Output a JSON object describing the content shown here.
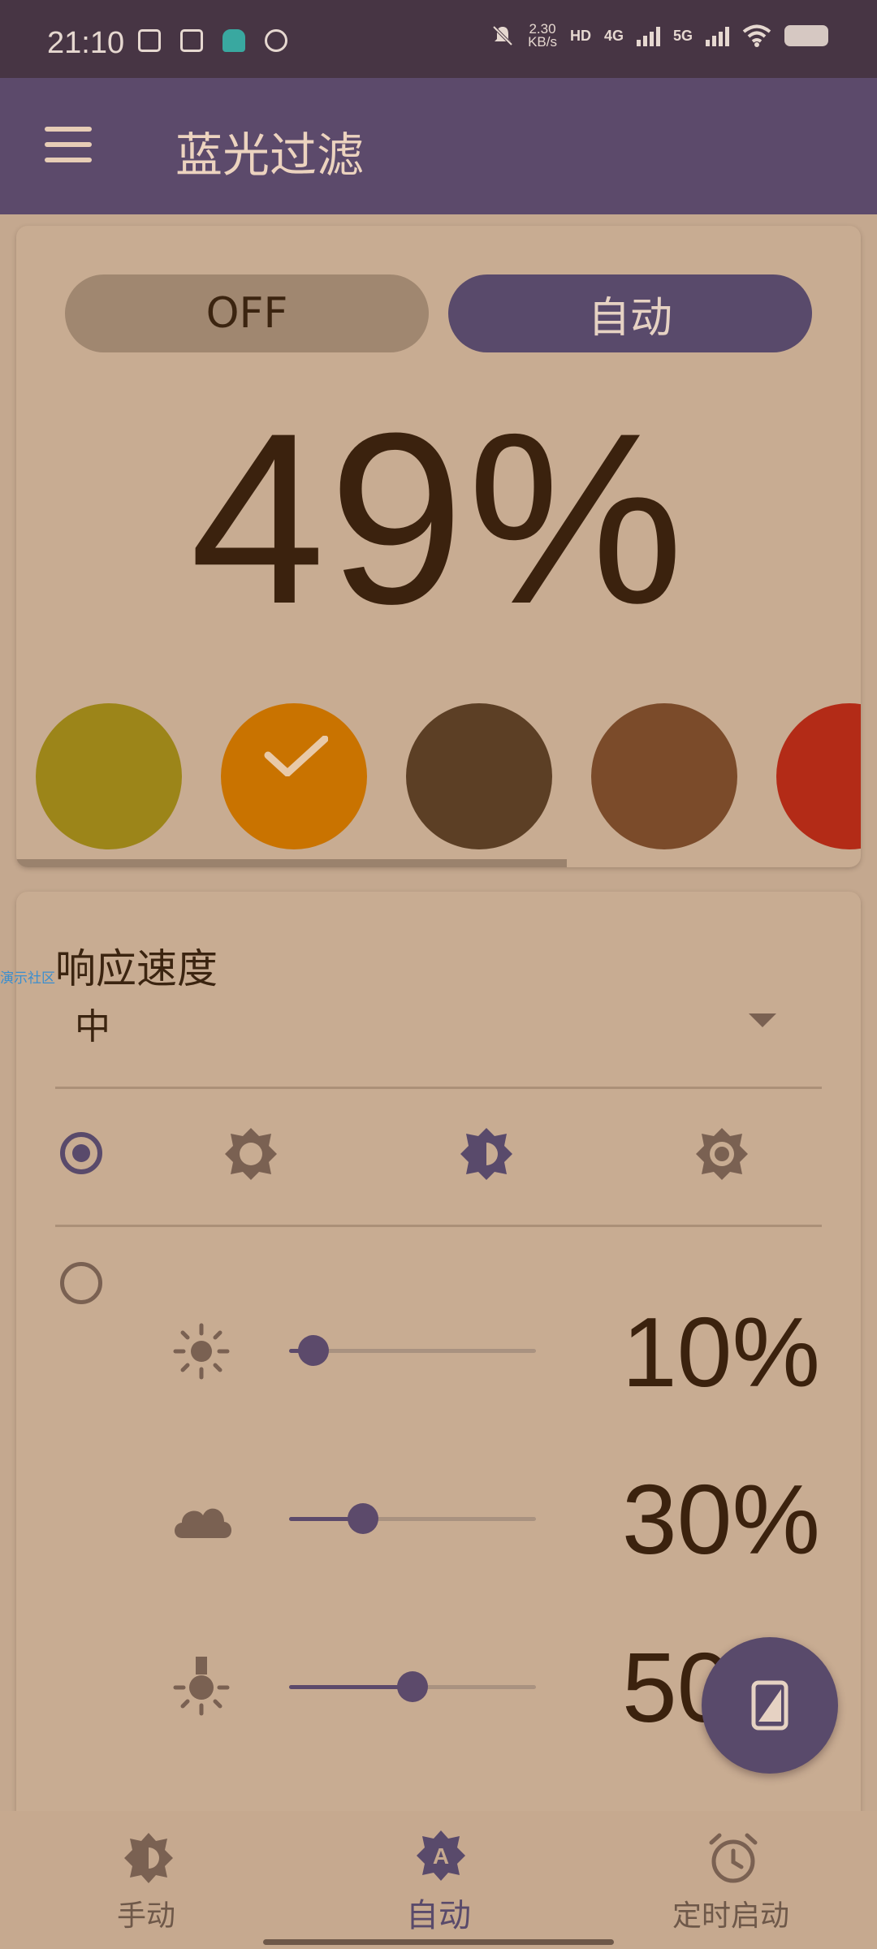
{
  "status_bar": {
    "time": "21:10",
    "net_speed_value": "2.30",
    "net_speed_unit": "KB/s",
    "hd_badge": "HD",
    "signal_1": "4G",
    "signal_2": "5G"
  },
  "app_bar": {
    "title": "蓝光过滤"
  },
  "filter_card": {
    "mode_off_label": "OFF",
    "mode_auto_label": "自动",
    "active_mode": "自动",
    "intensity": "49%",
    "swatches": [
      {
        "color": "#9c8519",
        "selected": false
      },
      {
        "color": "#c97300",
        "selected": true
      },
      {
        "color": "#5c3f25",
        "selected": false
      },
      {
        "color": "#7b4b2a",
        "selected": false
      },
      {
        "color": "#b32b17",
        "selected": false
      }
    ]
  },
  "settings_card": {
    "response_speed_label": "响应速度",
    "response_speed_value": "中",
    "watermark": "演示社区",
    "light_levels": [
      {
        "name": "sun",
        "value": "10%",
        "fraction": 0.1
      },
      {
        "name": "cloud",
        "value": "30%",
        "fraction": 0.3
      },
      {
        "name": "lamp",
        "value": "50%",
        "fraction": 0.5
      }
    ]
  },
  "bottom_nav": {
    "manual_label": "手动",
    "auto_label": "自动",
    "schedule_label": "定时启动",
    "active": "自动"
  },
  "colors": {
    "accent": "#594a6b",
    "app_bar": "#5c4a6b",
    "background": "#c4a88f",
    "text": "#3b2410"
  }
}
